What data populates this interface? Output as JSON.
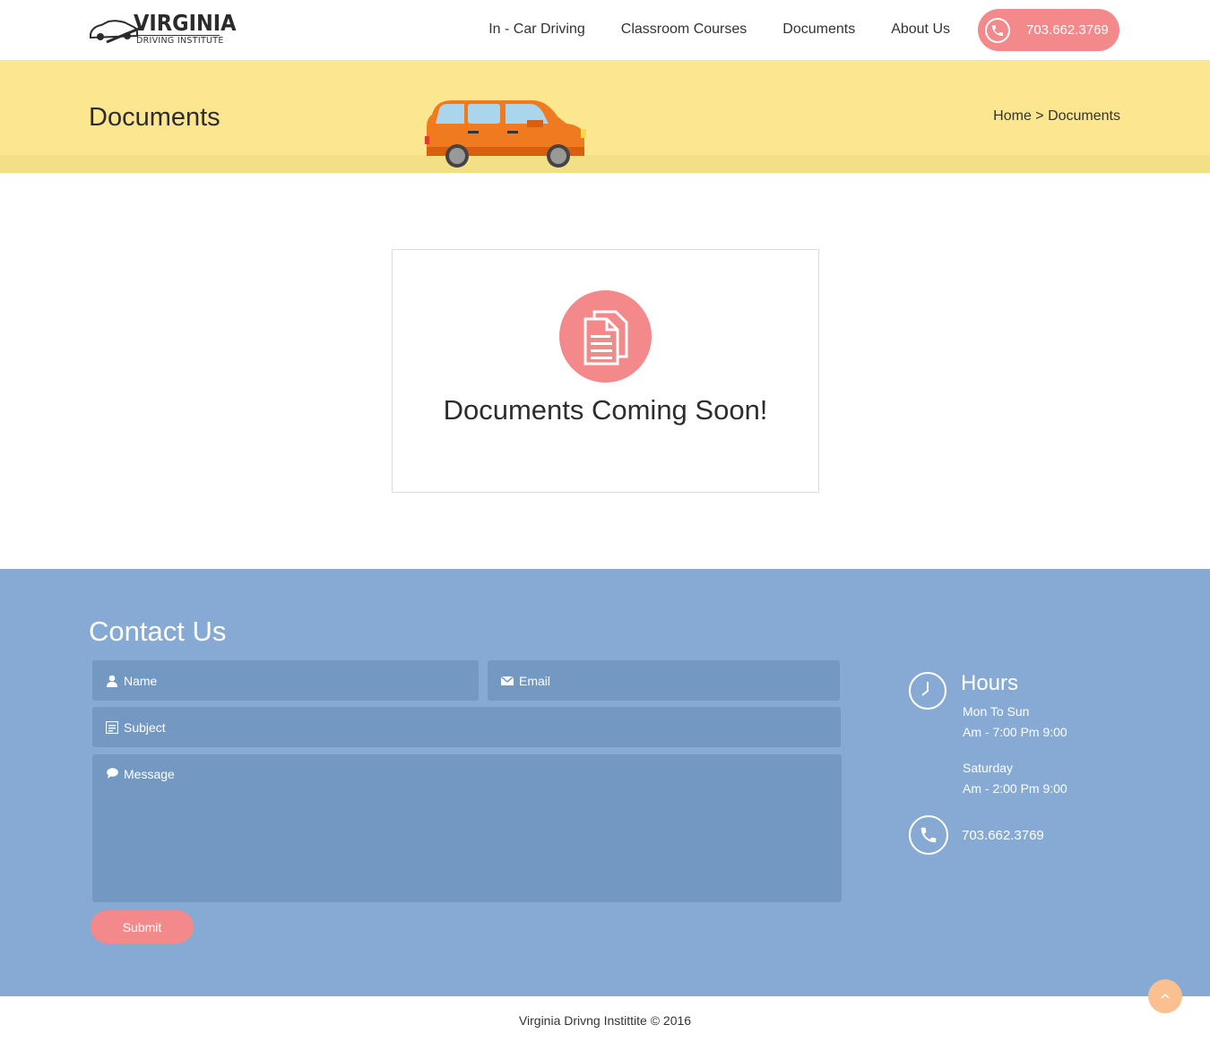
{
  "header": {
    "logo_brand": "VIRGINIA",
    "logo_sub": "DRIVING INSTITUTE",
    "nav": [
      "In - Car Driving",
      "Classroom Courses",
      "Documents",
      "About Us"
    ],
    "phone": "703.662.3769"
  },
  "title_band": {
    "page_title": "Documents",
    "breadcrumb": "Home > Documents"
  },
  "card": {
    "icon": "documents-icon",
    "title": "Documents Coming Soon!"
  },
  "contact": {
    "title": "Contact Us",
    "name_placeholder": "Name",
    "email_placeholder": "Email",
    "subject_placeholder": "Subject",
    "message_placeholder": "Message",
    "submit_label": "Submit",
    "hours_title": "Hours",
    "hours": [
      "Mon To Sun",
      "Am - 7:00 Pm 9:00",
      "Saturday",
      "Am - 2:00 Pm 9:00"
    ],
    "phone": "703.662.3769"
  },
  "footer": {
    "copyright": "Virginia Drivng Instittite © 2016"
  },
  "colors": {
    "accent_pink": "#f3898b",
    "title_band_yellow": "#fce68f",
    "contact_blue": "#86aad3",
    "field_blue": "#7399c3",
    "to_top_orange": "#fbc08f"
  }
}
